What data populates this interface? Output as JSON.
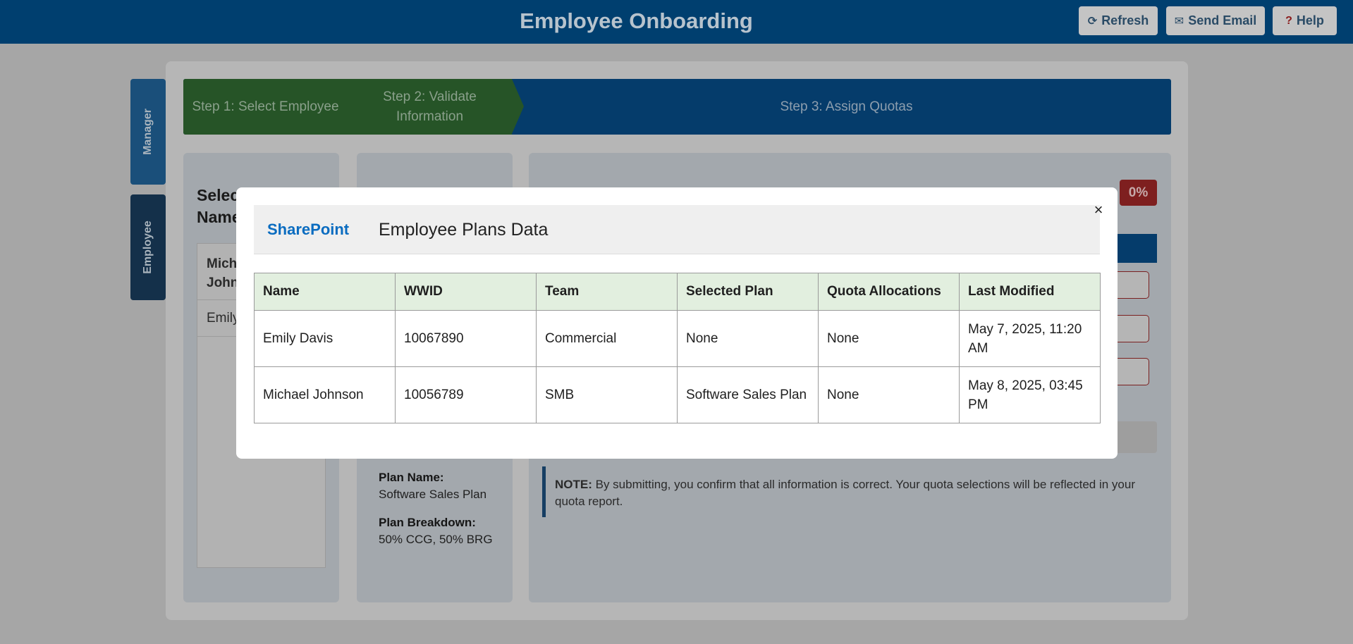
{
  "header": {
    "title": "Employee Onboarding",
    "buttons": {
      "refresh": "Refresh",
      "send_email": "Send Email",
      "help": "Help"
    },
    "colors": {
      "bar": "#005a9e"
    }
  },
  "side_tabs": [
    "Manager",
    "Employee"
  ],
  "steps": [
    "Step 1: Select Employee",
    "Step 2: Validate Information",
    "Step 3: Assign Quotas"
  ],
  "left_panel": {
    "heading_partial": "Selec Name",
    "employees": [
      "Mich John",
      "Emily"
    ]
  },
  "plan_info": {
    "plan_name_label": "Plan Name:",
    "plan_name": "Software Sales Plan",
    "breakdown_label": "Plan Breakdown:",
    "breakdown": "50% CCG, 50% BRG"
  },
  "quota": {
    "progress": "0%"
  },
  "note": {
    "label": "NOTE:",
    "text": "By submitting, you confirm that all information is correct. Your quota selections will be reflected in your quota report."
  },
  "modal": {
    "logo": "SharePoint",
    "title": "Employee Plans Data",
    "close": "×",
    "columns": [
      "Name",
      "WWID",
      "Team",
      "Selected Plan",
      "Quota Allocations",
      "Last Modified"
    ],
    "rows": [
      [
        "Emily Davis",
        "10067890",
        "Commercial",
        "None",
        "None",
        "May 7, 2025, 11:20 AM"
      ],
      [
        "Michael Johnson",
        "10056789",
        "SMB",
        "Software Sales Plan",
        "None",
        "May 8, 2025, 03:45 PM"
      ]
    ]
  }
}
